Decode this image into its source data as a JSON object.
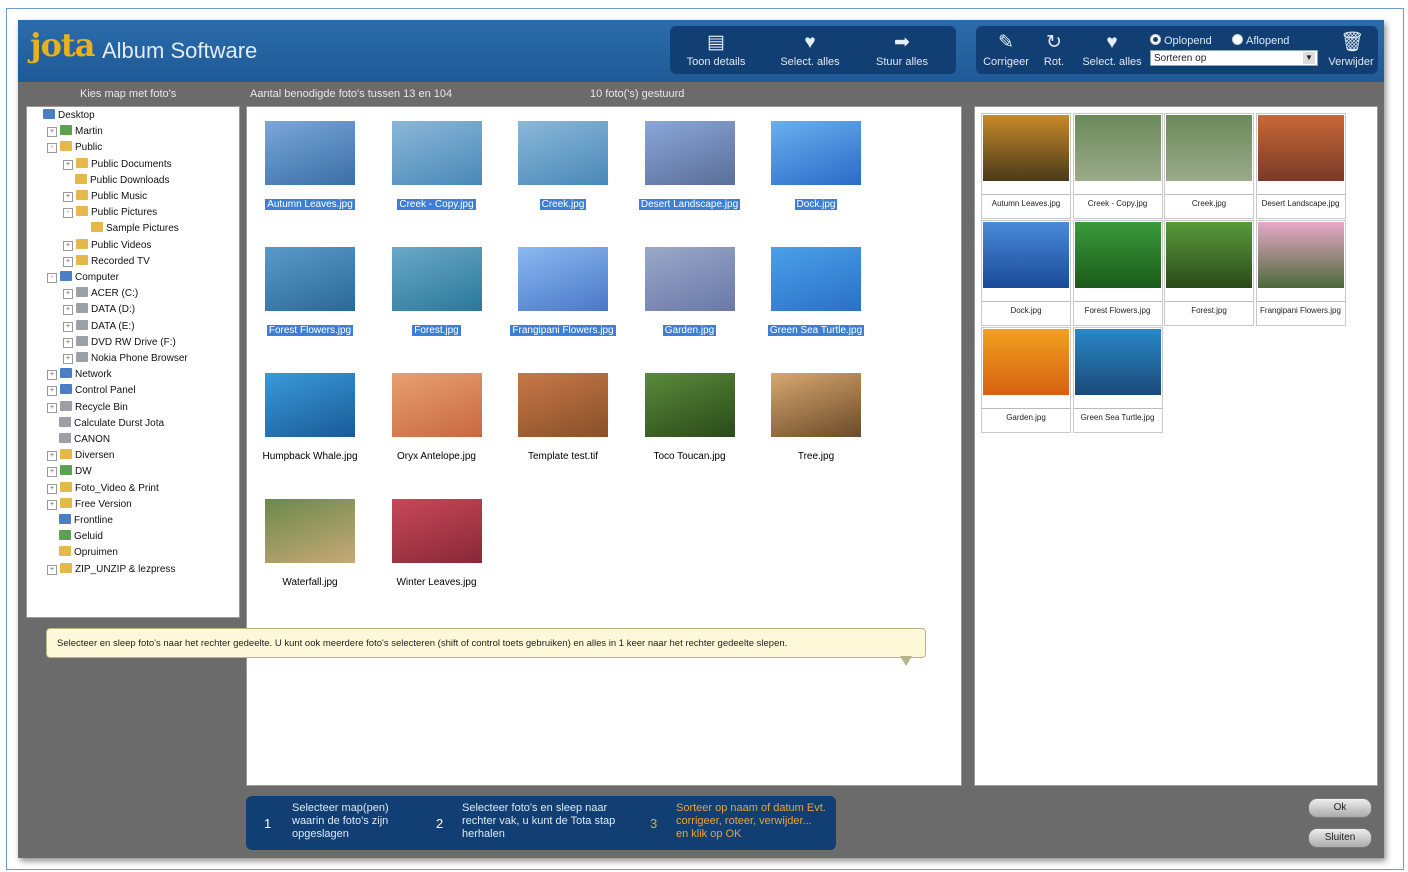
{
  "app": {
    "logo": "jota",
    "name": "Album Software"
  },
  "toolbar1": [
    {
      "label": "Toon details",
      "icon": "details-icon"
    },
    {
      "label": "Select. alles",
      "icon": "select-all-icon"
    },
    {
      "label": "Stuur alles",
      "icon": "send-all-icon"
    }
  ],
  "toolbar2": [
    {
      "label": "Corrigeer",
      "icon": "correct-icon"
    },
    {
      "label": "Rot.",
      "icon": "rotate-icon"
    },
    {
      "label": "Select. alles",
      "icon": "select-all-icon"
    }
  ],
  "sort": {
    "asc": "Oplopend",
    "desc": "Aflopend",
    "select": "Sorteren op",
    "delete": "Verwijder"
  },
  "labels": {
    "folder": "Kies map met foto's",
    "count": "Aantal benodigde foto's tussen  13 en 104",
    "sent": "10 foto('s) gestuurd"
  },
  "tree": [
    {
      "label": "Desktop",
      "exp": "",
      "icon": "blue"
    },
    {
      "label": "Martin",
      "exp": "+",
      "icon": "green"
    },
    {
      "label": "Public",
      "exp": "-",
      "icon": "folder"
    },
    {
      "label": "Public Documents",
      "exp": "+",
      "icon": "folder"
    },
    {
      "label": "Public Downloads",
      "exp": "",
      "icon": "folder"
    },
    {
      "label": "Public Music",
      "exp": "+",
      "icon": "folder"
    },
    {
      "label": "Public Pictures",
      "exp": "-",
      "icon": "folder"
    },
    {
      "label": "Sample Pictures",
      "exp": "",
      "icon": "folder"
    },
    {
      "label": "Public Videos",
      "exp": "+",
      "icon": "folder"
    },
    {
      "label": "Recorded TV",
      "exp": "+",
      "icon": "folder"
    },
    {
      "label": "Computer",
      "exp": "-",
      "icon": "blue"
    },
    {
      "label": "ACER (C:)",
      "exp": "+",
      "icon": "gray"
    },
    {
      "label": "DATA (D:)",
      "exp": "+",
      "icon": "gray"
    },
    {
      "label": "DATA (E:)",
      "exp": "+",
      "icon": "gray"
    },
    {
      "label": "DVD RW Drive (F:)",
      "exp": "+",
      "icon": "gray"
    },
    {
      "label": "Nokia Phone Browser",
      "exp": "+",
      "icon": "gray"
    },
    {
      "label": "Network",
      "exp": "+",
      "icon": "blue"
    },
    {
      "label": "Control Panel",
      "exp": "+",
      "icon": "blue"
    },
    {
      "label": "Recycle Bin",
      "exp": "+",
      "icon": "gray"
    },
    {
      "label": "Calculate Durst Jota",
      "exp": "",
      "icon": "gray"
    },
    {
      "label": "CANON",
      "exp": "",
      "icon": "gray"
    },
    {
      "label": "Diversen",
      "exp": "+",
      "icon": "folder"
    },
    {
      "label": "DW",
      "exp": "+",
      "icon": "green"
    },
    {
      "label": "Foto_Video    & Print",
      "exp": "+",
      "icon": "folder"
    },
    {
      "label": "Free Version",
      "exp": "+",
      "icon": "folder"
    },
    {
      "label": "Frontline",
      "exp": "",
      "icon": "blue"
    },
    {
      "label": "Geluid",
      "exp": "",
      "icon": "green"
    },
    {
      "label": "Opruimen",
      "exp": "",
      "icon": "folder"
    },
    {
      "label": "ZIP_UNZIP  & lezpress",
      "exp": "+",
      "icon": "folder"
    }
  ],
  "photos": [
    {
      "name": "Autumn Leaves.jpg",
      "selected": true,
      "colors": [
        "#7aa8d8",
        "#3a6ea6"
      ]
    },
    {
      "name": "Creek - Copy.jpg",
      "selected": true,
      "colors": [
        "#8ab8d8",
        "#4a88b8"
      ]
    },
    {
      "name": "Creek.jpg",
      "selected": true,
      "colors": [
        "#8ab8d8",
        "#4a88b8"
      ]
    },
    {
      "name": "Desert Landscape.jpg",
      "selected": true,
      "colors": [
        "#8aa6d8",
        "#5a6e98"
      ]
    },
    {
      "name": "Dock.jpg",
      "selected": true,
      "colors": [
        "#6ab0ee",
        "#2a6ac8"
      ]
    },
    {
      "name": "Forest Flowers.jpg",
      "selected": true,
      "colors": [
        "#5a9ac8",
        "#2a6898"
      ]
    },
    {
      "name": "Forest.jpg",
      "selected": true,
      "colors": [
        "#6aa8c8",
        "#2a7898"
      ]
    },
    {
      "name": "Frangipani Flowers.jpg",
      "selected": true,
      "colors": [
        "#8ab8f0",
        "#4a78c8"
      ]
    },
    {
      "name": "Garden.jpg",
      "selected": true,
      "colors": [
        "#9aa8c8",
        "#6a78a8"
      ]
    },
    {
      "name": "Green Sea Turtle.jpg",
      "selected": true,
      "colors": [
        "#4aa0e8",
        "#2a70c8"
      ]
    },
    {
      "name": "Humpback Whale.jpg",
      "selected": false,
      "colors": [
        "#3a9ad8",
        "#1a5a98"
      ]
    },
    {
      "name": "Oryx Antelope.jpg",
      "selected": false,
      "colors": [
        "#e8a070",
        "#c86840"
      ]
    },
    {
      "name": "Template test.tif",
      "selected": false,
      "colors": [
        "#c87848",
        "#885028"
      ]
    },
    {
      "name": "Toco Toucan.jpg",
      "selected": false,
      "colors": [
        "#5a8a3a",
        "#2a4a1a"
      ]
    },
    {
      "name": "Tree.jpg",
      "selected": false,
      "colors": [
        "#d8a870",
        "#6a4a28"
      ]
    },
    {
      "name": "Waterfall.jpg",
      "selected": false,
      "colors": [
        "#6a8a4a",
        "#c8a878"
      ]
    },
    {
      "name": "Winter Leaves.jpg",
      "selected": false,
      "colors": [
        "#c84858",
        "#882838"
      ]
    }
  ],
  "sent_photos": [
    {
      "name": "Autumn Leaves.jpg",
      "colors": [
        "#c88a2a",
        "#4a3a1a"
      ]
    },
    {
      "name": "Creek - Copy.jpg",
      "colors": [
        "#6a8a5a",
        "#9aaa8a"
      ]
    },
    {
      "name": "Creek.jpg",
      "colors": [
        "#6a8a5a",
        "#9aaa8a"
      ]
    },
    {
      "name": "Desert Landscape.jpg",
      "colors": [
        "#c86838",
        "#7a3a28"
      ]
    },
    {
      "name": "Dock.jpg",
      "colors": [
        "#4a8ad8",
        "#1a4a98"
      ]
    },
    {
      "name": "Forest Flowers.jpg",
      "colors": [
        "#3a9a3a",
        "#1a5a1a"
      ]
    },
    {
      "name": "Forest.jpg",
      "colors": [
        "#5a9a3a",
        "#2a4a1a"
      ]
    },
    {
      "name": "Frangipani Flowers.jpg",
      "colors": [
        "#e8a8c8",
        "#4a6a3a"
      ]
    },
    {
      "name": "Garden.jpg",
      "colors": [
        "#f0a020",
        "#d86010"
      ]
    },
    {
      "name": "Green Sea Turtle.jpg",
      "colors": [
        "#2a88c8",
        "#1a4a78"
      ]
    }
  ],
  "tip": "Selecteer en sleep foto's naar het rechter gedeelte. U kunt ook meerdere foto's selecteren (shift of control toets gebruiken) en alles in 1 keer naar het rechter gedeelte slepen.",
  "steps": [
    {
      "num": "1",
      "text": "Selecteer map(pen) waarin de foto's zijn opgeslagen"
    },
    {
      "num": "2",
      "text": "Selecteer foto's en sleep naar rechter vak, u kunt de Tota stap herhalen"
    },
    {
      "num": "3",
      "text": "Sorteer op naam of datum Evt. corrigeer, roteer, verwijder... en klik op OK"
    }
  ],
  "buttons": {
    "ok": "Ok",
    "close": "Sluiten"
  }
}
